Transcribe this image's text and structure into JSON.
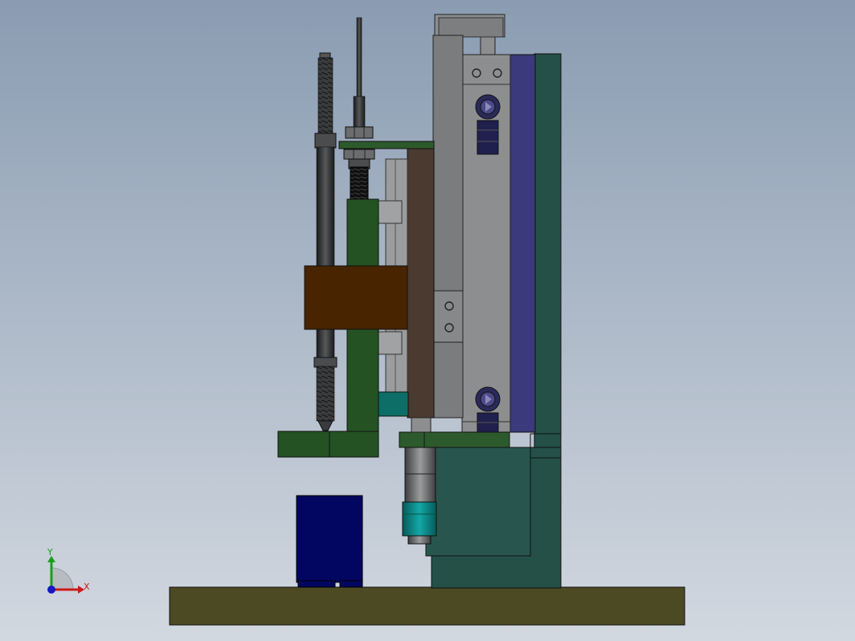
{
  "viewport": {
    "background_top": "#8a9cb2",
    "background_bottom": "#d2d8e0"
  },
  "triad": {
    "x_label": "X",
    "y_label": "Y",
    "x_color": "#d01818",
    "y_color": "#18a018",
    "z_color": "#1818c0"
  },
  "colors": {
    "base_plate": "#4b4a22",
    "pillar": "#245048",
    "blue_block": "#020660",
    "green_bracket": "#245223",
    "brown_block": "#482400",
    "rod_dark": "#2f3031",
    "guide_gray": "#7a7c7e",
    "purple_plate": "#3a3a7c",
    "cylinder_body": "#8c8e90",
    "teal_ring": "#0a8888",
    "fitting_navy": "#20204e"
  }
}
